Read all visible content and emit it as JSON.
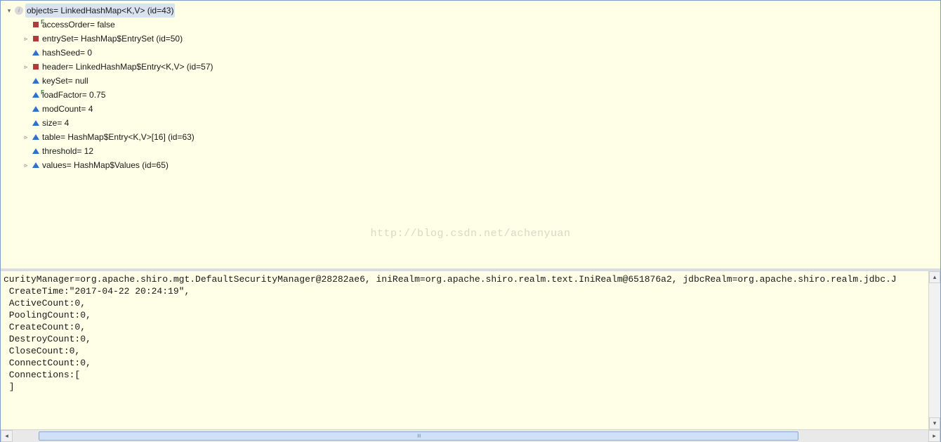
{
  "watermark": "http://blog.csdn.net/achenyuan",
  "tree": {
    "root": {
      "expander": "▾",
      "icon": "circle-i",
      "label": "objects= LinkedHashMap<K,V>  (id=43)",
      "selected": true,
      "indent": 6
    },
    "children": [
      {
        "expander": "",
        "icon": "sq-red",
        "badge": "F",
        "label": "accessOrder= false",
        "indent": 42
      },
      {
        "expander": "▹",
        "icon": "sq-red",
        "badge": "",
        "label": "entrySet= HashMap$EntrySet  (id=50)",
        "indent": 30
      },
      {
        "expander": "",
        "icon": "tri-blue",
        "badge": "",
        "label": "hashSeed= 0",
        "indent": 42
      },
      {
        "expander": "▹",
        "icon": "sq-red",
        "badge": "",
        "label": "header= LinkedHashMap$Entry<K,V>  (id=57)",
        "indent": 30
      },
      {
        "expander": "",
        "icon": "tri-blue",
        "badge": "",
        "label": "keySet= null",
        "indent": 42
      },
      {
        "expander": "",
        "icon": "tri-blue",
        "badge": "F",
        "label": "loadFactor= 0.75",
        "indent": 42
      },
      {
        "expander": "",
        "icon": "tri-blue",
        "badge": "",
        "label": "modCount= 4",
        "indent": 42
      },
      {
        "expander": "",
        "icon": "tri-blue",
        "badge": "",
        "label": "size= 4",
        "indent": 42
      },
      {
        "expander": "▹",
        "icon": "tri-blue",
        "badge": "",
        "label": "table= HashMap$Entry<K,V>[16]  (id=63)",
        "indent": 30
      },
      {
        "expander": "",
        "icon": "tri-blue",
        "badge": "",
        "label": "threshold= 12",
        "indent": 42
      },
      {
        "expander": "▹",
        "icon": "tri-blue",
        "badge": "",
        "label": "values= HashMap$Values  (id=65)",
        "indent": 30
      }
    ]
  },
  "console": {
    "lines": [
      "curityManager=org.apache.shiro.mgt.DefaultSecurityManager@28282ae6, iniRealm=org.apache.shiro.realm.text.IniRealm@651876a2, jdbcRealm=org.apache.shiro.realm.jdbc.J",
      " CreateTime:\"2017-04-22 20:24:19\",",
      " ActiveCount:0,",
      " PoolingCount:0,",
      " CreateCount:0,",
      " DestroyCount:0,",
      " CloseCount:0,",
      " ConnectCount:0,",
      " Connections:[",
      " ]"
    ]
  },
  "scroll": {
    "left_glyph": "◂",
    "right_glyph": "▸",
    "up_glyph": "▴",
    "down_glyph": "▾"
  }
}
